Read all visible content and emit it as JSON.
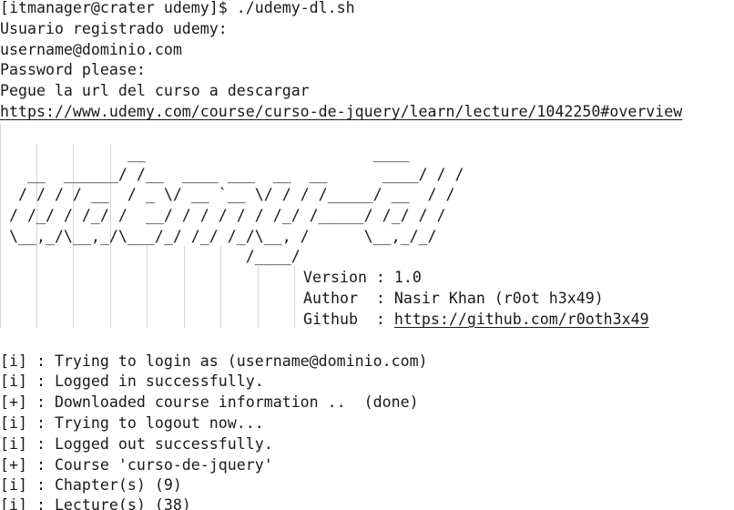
{
  "terminal": {
    "prompt": "[itmanager@crater udemy]$ ./udemy-dl.sh",
    "username_prompt": "Usuario registrado udemy:",
    "username_value": "username@dominio.com",
    "password_prompt": "Password please:",
    "url_prompt": "Pegue la url del curso a descargar",
    "course_url": "https://www.udemy.com/course/curso-de-jquery/learn/lecture/1042250#overview"
  },
  "banner": {
    "art": [
      "              __                         ____",
      "   __  ______/ /__  ____ ___  __  __      ____/ / /",
      "  / / / / __  / _ \\/ __ `__ \\/ / / /_____/ __  / /",
      " / /_/ / /_/ /  __/ / / / / / /_/ /_____/ /_/ / /",
      " \\__,_/\\__,_/\\___/_/ /_/ /_/\\__, /      \\__,_/_/",
      "                           /____/"
    ],
    "version_label": "Version : ",
    "version_value": "1.0",
    "author_label": "Author  : ",
    "author_value": "Nasir Khan (r0ot h3x49)",
    "github_label": "Github  : ",
    "github_url": "https://github.com/r0oth3x49"
  },
  "log": [
    "[i] : Trying to login as (username@dominio.com)",
    "[i] : Logged in successfully.",
    "[+] : Downloaded course information ..  (done)",
    "[i] : Trying to logout now...",
    "[i] : Logged out successfully.",
    "[+] : Course 'curso-de-jquery'",
    "[i] : Chapter(s) (9)",
    "[i] : Lecture(s) (38)"
  ]
}
